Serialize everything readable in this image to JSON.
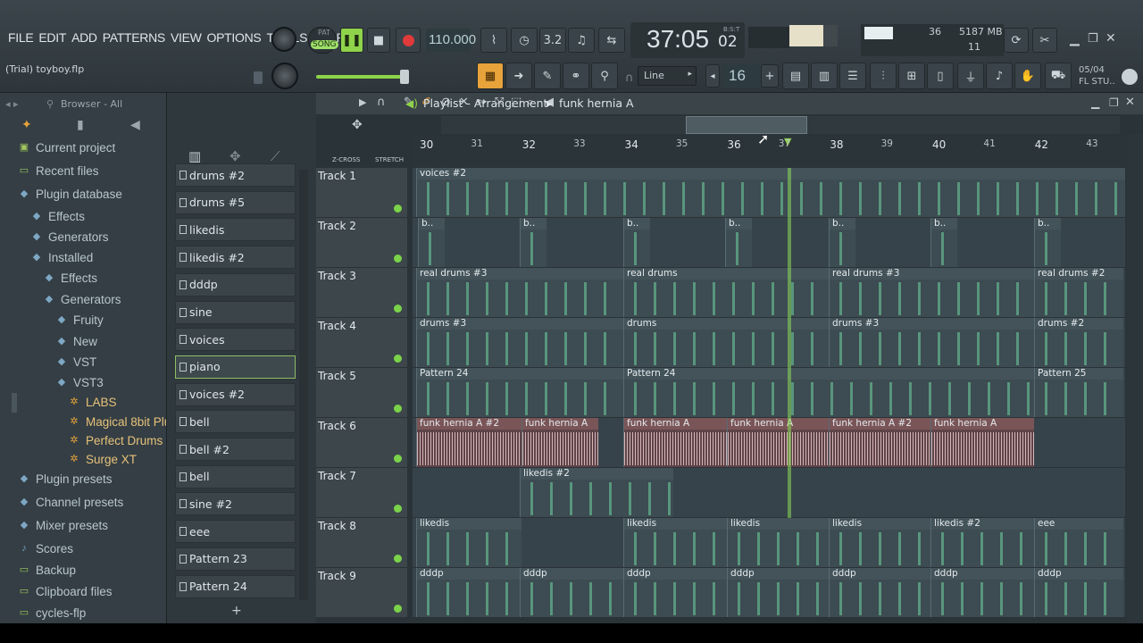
{
  "menu": [
    "FILE",
    "EDIT",
    "ADD",
    "PATTERNS",
    "VIEW",
    "OPTIONS",
    "TOOLS",
    "HELP"
  ],
  "project_title": "(Trial) toyboy.flp",
  "transport": {
    "pat_label": "PAT",
    "song_label": "SONG",
    "tempo": "110.000",
    "time_main": "37:05",
    "time_sub": "02",
    "time_unit": "B:S:T"
  },
  "snap": {
    "mode": "Line",
    "step": "16"
  },
  "monitor": {
    "cpu": "36",
    "mem": "5187 MB",
    "poly": "11"
  },
  "news": {
    "date": "05/04",
    "label": "FL STU.."
  },
  "browser": {
    "header": "Browser - All",
    "items": [
      {
        "label": "Current project",
        "icon": "project-icon"
      },
      {
        "label": "Recent files",
        "icon": "folder-icon"
      },
      {
        "label": "Plugin database",
        "icon": "plug-icon"
      },
      {
        "label": "Effects",
        "icon": "plug-icon"
      },
      {
        "label": "Generators",
        "icon": "plug-icon"
      },
      {
        "label": "Installed",
        "icon": "plug-icon"
      },
      {
        "label": "Effects",
        "icon": "plug-icon"
      },
      {
        "label": "Generators",
        "icon": "plug-icon"
      },
      {
        "label": "Fruity",
        "icon": "plug-icon"
      },
      {
        "label": "New",
        "icon": "plug-icon"
      },
      {
        "label": "VST",
        "icon": "plug-icon"
      },
      {
        "label": "VST3",
        "icon": "plug-icon"
      },
      {
        "label": "LABS",
        "icon": "gear-icon"
      },
      {
        "label": "Magical 8bit Plug 2",
        "icon": "gear-icon"
      },
      {
        "label": "Perfect Drums",
        "icon": "gear-icon"
      },
      {
        "label": "Surge XT",
        "icon": "gear-icon"
      },
      {
        "label": "Plugin presets",
        "icon": "preset-icon"
      },
      {
        "label": "Channel presets",
        "icon": "preset-icon"
      },
      {
        "label": "Mixer presets",
        "icon": "preset-icon"
      },
      {
        "label": "Scores",
        "icon": "note-icon"
      },
      {
        "label": "Backup",
        "icon": "folder-icon"
      },
      {
        "label": "Clipboard files",
        "icon": "folder-icon"
      },
      {
        "label": "cycles-flp",
        "icon": "folder-icon"
      }
    ]
  },
  "patterns": [
    "drums #2",
    "drums #5",
    "likedis",
    "likedis #2",
    "dddp",
    "sine",
    "voices",
    "piano",
    "voices #2",
    "bell",
    "bell #2",
    "bell",
    "sine #2",
    "eee",
    "Pattern 23",
    "Pattern 24"
  ],
  "playlist": {
    "title": "Playlist - Arrangement",
    "current_pattern": "funk hernia A",
    "zcross": "Z-CROSS",
    "stretch": "STRETCH",
    "bars": [
      "30",
      "31",
      "32",
      "33",
      "34",
      "35",
      "36",
      "37",
      "38",
      "39",
      "40",
      "41",
      "42",
      "43"
    ],
    "tracks": [
      {
        "name": "Track 1",
        "clips": [
          {
            "label": "voices #2",
            "kind": "midi"
          }
        ]
      },
      {
        "name": "Track 2",
        "clips": [
          {
            "label": "b..",
            "kind": "midi"
          },
          {
            "label": "b..",
            "kind": "midi"
          },
          {
            "label": "b..",
            "kind": "midi"
          },
          {
            "label": "b..",
            "kind": "midi"
          },
          {
            "label": "b..",
            "kind": "midi"
          },
          {
            "label": "b..",
            "kind": "midi"
          },
          {
            "label": "b..",
            "kind": "midi"
          }
        ]
      },
      {
        "name": "Track 3",
        "clips": [
          {
            "label": "real drums #3",
            "kind": "midi"
          },
          {
            "label": "real drums",
            "kind": "midi"
          },
          {
            "label": "real drums #3",
            "kind": "midi"
          },
          {
            "label": "real drums #2",
            "kind": "midi"
          }
        ]
      },
      {
        "name": "Track 4",
        "clips": [
          {
            "label": "drums #3",
            "kind": "midi"
          },
          {
            "label": "drums",
            "kind": "midi"
          },
          {
            "label": "drums #3",
            "kind": "midi"
          },
          {
            "label": "drums #2",
            "kind": "midi"
          }
        ]
      },
      {
        "name": "Track 5",
        "clips": [
          {
            "label": "Pattern 24",
            "kind": "midi"
          },
          {
            "label": "Pattern 24",
            "kind": "midi"
          },
          {
            "label": "Pattern 25",
            "kind": "midi"
          }
        ]
      },
      {
        "name": "Track 6",
        "clips": [
          {
            "label": "funk hernia A #2",
            "kind": "audio"
          },
          {
            "label": "funk hernia A",
            "kind": "audio"
          },
          {
            "label": "funk hernia A",
            "kind": "audio"
          },
          {
            "label": "funk hernia A",
            "kind": "audio"
          },
          {
            "label": "funk hernia A #2",
            "kind": "audio"
          },
          {
            "label": "funk hernia A",
            "kind": "audio"
          }
        ]
      },
      {
        "name": "Track 7",
        "clips": [
          {
            "label": "likedis #2",
            "kind": "midi"
          }
        ]
      },
      {
        "name": "Track 8",
        "clips": [
          {
            "label": "likedis",
            "kind": "midi"
          },
          {
            "label": "likedis",
            "kind": "midi"
          },
          {
            "label": "likedis",
            "kind": "midi"
          },
          {
            "label": "likedis",
            "kind": "midi"
          },
          {
            "label": "likedis #2",
            "kind": "midi"
          },
          {
            "label": "eee",
            "kind": "midi"
          }
        ]
      },
      {
        "name": "Track 9",
        "clips": [
          {
            "label": "dddp",
            "kind": "midi"
          },
          {
            "label": "dddp",
            "kind": "midi"
          },
          {
            "label": "dddp",
            "kind": "midi"
          },
          {
            "label": "dddp",
            "kind": "midi"
          },
          {
            "label": "dddp",
            "kind": "midi"
          },
          {
            "label": "dddp",
            "kind": "midi"
          },
          {
            "label": "dddp",
            "kind": "midi"
          }
        ]
      }
    ]
  },
  "colors": {
    "accent_green": "#7bd34a",
    "orange": "#e8a33a",
    "audio_clip": "#5e4448"
  }
}
